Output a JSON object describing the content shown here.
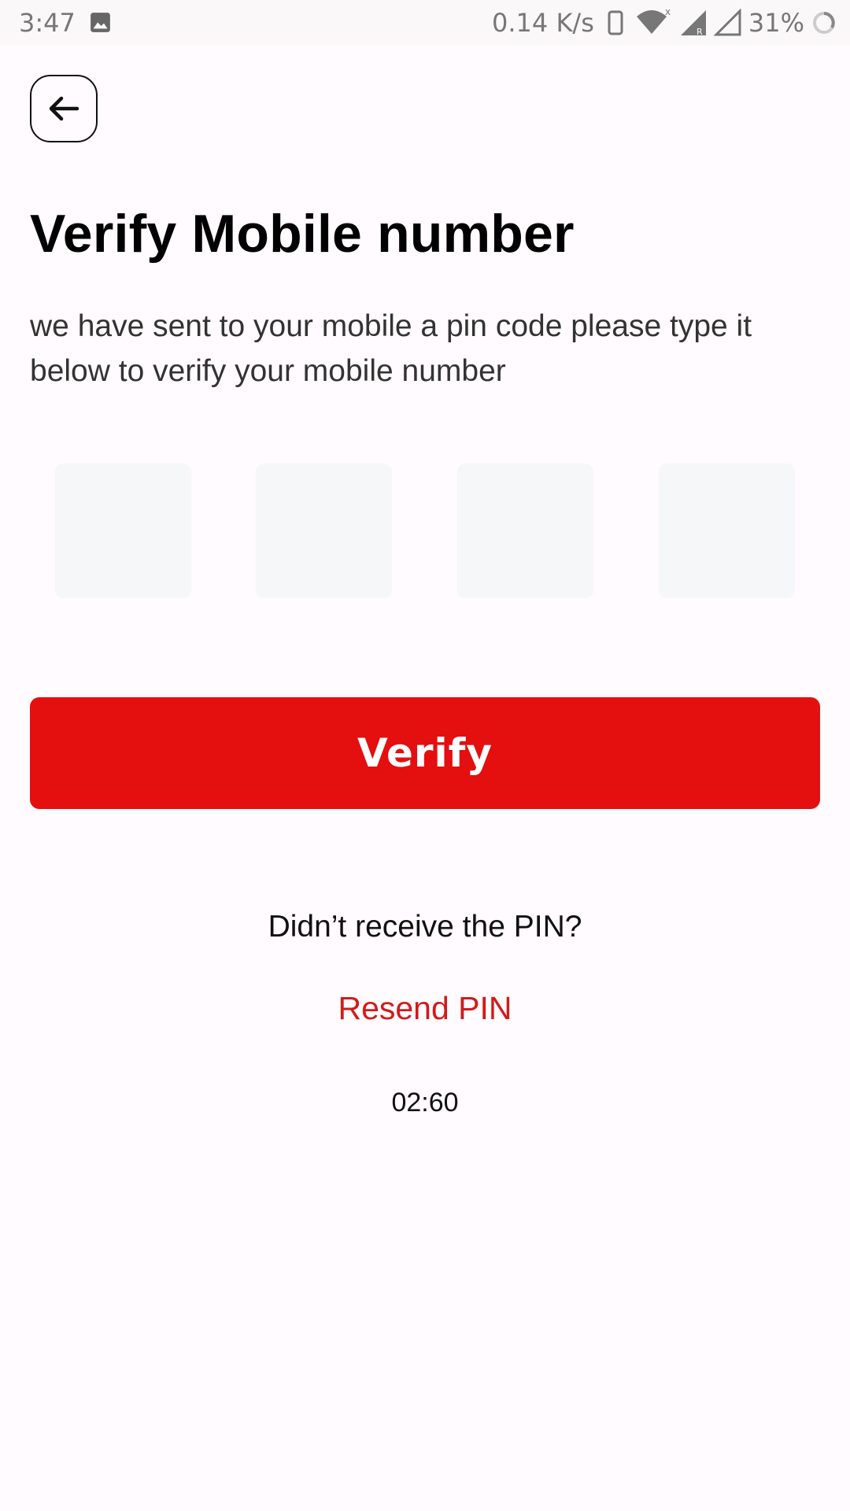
{
  "status_bar": {
    "time": "3:47",
    "network_speed": "0.14 K/s",
    "battery": "31%",
    "icons": [
      "image-icon",
      "vibrate-icon",
      "wifi-icon",
      "signal-icon",
      "signal-empty-icon",
      "battery-ring-icon"
    ]
  },
  "header": {
    "back_icon": "arrow-left-icon"
  },
  "main": {
    "title": "Verify Mobile number",
    "subtitle": "we have sent to your mobile a pin code please type it below to verify your mobile number",
    "pin_fields": [
      "",
      "",
      "",
      ""
    ],
    "verify_label": "Verify",
    "question": "Didn’t receive the PIN?",
    "resend_label": "Resend PIN",
    "timer": "02:60"
  },
  "colors": {
    "accent": "#e40f0f",
    "resend": "#d21a1a",
    "background": "#fffbfe",
    "pin_box": "#f6f7f8"
  }
}
